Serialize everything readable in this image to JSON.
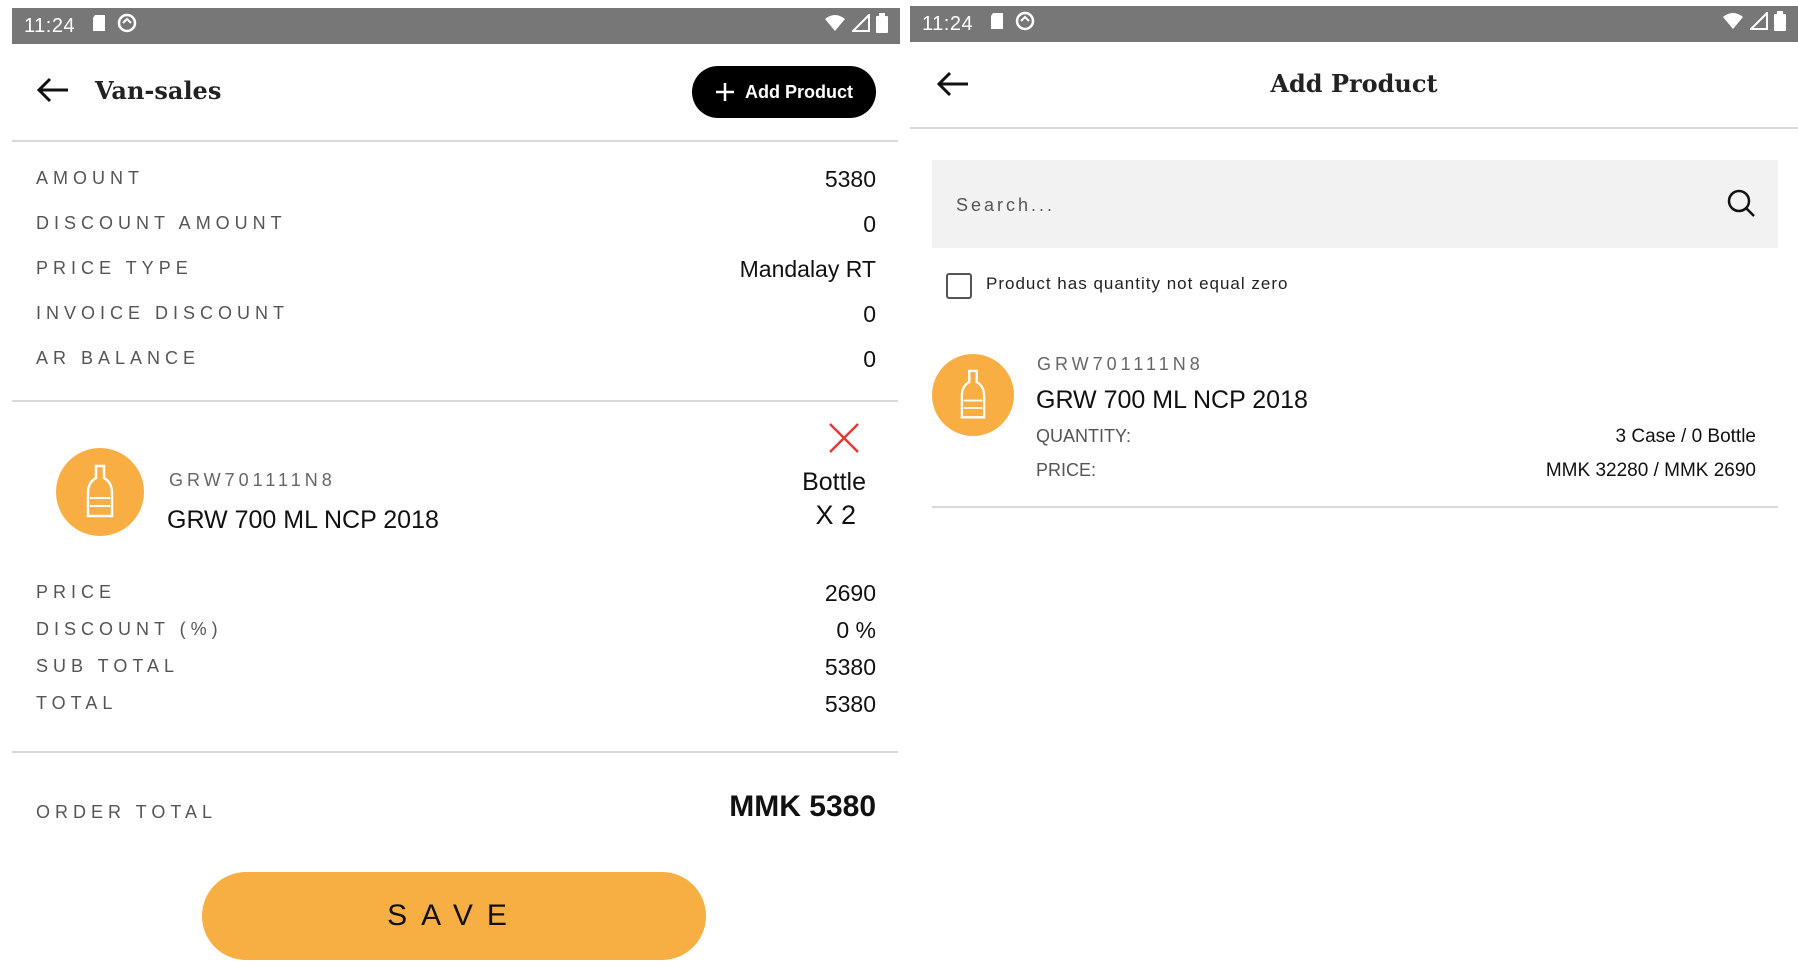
{
  "status_bar": {
    "time": "11:24"
  },
  "left": {
    "title": "Van-sales",
    "add_product_label": "Add Product",
    "summary": [
      {
        "label": "AMOUNT",
        "value": "5380"
      },
      {
        "label": "DISCOUNT AMOUNT",
        "value": "0"
      },
      {
        "label": "PRICE TYPE",
        "value": "Mandalay RT"
      },
      {
        "label": "INVOICE DISCOUNT",
        "value": "0"
      },
      {
        "label": "AR BALANCE",
        "value": "0"
      }
    ],
    "item": {
      "code": "GRW701111N8",
      "name": "GRW 700 ML NCP 2018",
      "unit": "Bottle",
      "qty": "X 2",
      "details": [
        {
          "label": "PRICE",
          "value": "2690"
        },
        {
          "label": "DISCOUNT (%)",
          "value": "0 %"
        },
        {
          "label": "SUB TOTAL",
          "value": "5380"
        },
        {
          "label": "TOTAL",
          "value": "5380"
        }
      ]
    },
    "order_total_label": "ORDER TOTAL",
    "order_total_value": "MMK 5380",
    "save_label": "SAVE"
  },
  "right": {
    "title": "Add Product",
    "search_placeholder": "Search...",
    "filter_label": "Product has quantity not equal zero",
    "product": {
      "code": "GRW701111N8",
      "name": "GRW 700 ML NCP 2018",
      "quantity_label": "QUANTITY:",
      "quantity_value": "3 Case / 0 Bottle",
      "price_label": "PRICE:",
      "price_value": "MMK 32280 / MMK 2690"
    }
  },
  "colors": {
    "accent": "#f8ae42",
    "status_bar": "#777777",
    "remove": "#e53935"
  }
}
